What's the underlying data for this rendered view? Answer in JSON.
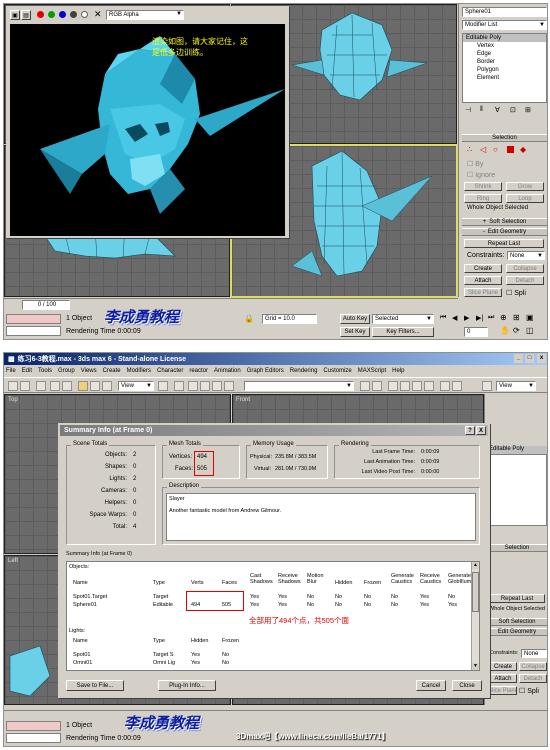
{
  "top": {
    "render_window": {
      "channel_select": "RGB Alpha",
      "caption_line1": "渲染如图，请大家记住，这",
      "caption_line2": "是低多边训练。"
    },
    "command_panel": {
      "object_name": "Sphere01",
      "modifier_list": "Modifier List",
      "stack": [
        "Editable Poly",
        "Vertex",
        "Edge",
        "Border",
        "Polygon",
        "Element"
      ],
      "selection_rollout": "Selection",
      "by_vertex": "By",
      "ignore_backfacing": "Ignore",
      "shrink": "Shrink",
      "grow": "Grow",
      "ring": "Ring",
      "loop": "Loop",
      "whole_object": "Whole Object Selected",
      "soft_selection": "Soft Selection",
      "edit_geometry": "Edit Geometry",
      "repeat_last": "Repeat Last",
      "constraints_label": "Constraints:",
      "constraints_value": "None",
      "create": "Create",
      "collapse": "Collapse",
      "attach": "Attach",
      "detach": "Detach",
      "slice_plane": "Slice Plane",
      "split": "Spli"
    },
    "status": {
      "frame_counter": "0 / 100",
      "object_count": "1 Object",
      "rendering_time": "Rendering Time  0:00:09",
      "grid": "Grid = 10.0",
      "auto_key": "Auto Key",
      "selected": "Selected",
      "set_key": "Set Key",
      "key_filters": "Key Filters...",
      "frame_value": "0",
      "watermark": "李成勇教程"
    }
  },
  "bottom": {
    "app_title": "练习6-3教程.max - 3ds max 6 - Stand-alone License",
    "menu": [
      "File",
      "Edit",
      "Tools",
      "Group",
      "Views",
      "Create",
      "Modifiers",
      "Character",
      "reactor",
      "Animation",
      "Graph Editors",
      "Rendering",
      "Customize",
      "MAXScript",
      "Help"
    ],
    "view_select": "View",
    "viewports": {
      "top": "Top",
      "front": "Front",
      "left": "Left"
    },
    "dialog": {
      "title": "Summary Info (at Frame 0)",
      "help_btn": "?",
      "close_btn": "X",
      "scene_totals": {
        "title": "Scene Totals",
        "rows": [
          {
            "label": "Objects:",
            "value": "2"
          },
          {
            "label": "Shapes:",
            "value": "0"
          },
          {
            "label": "Lights:",
            "value": "2"
          },
          {
            "label": "Cameras:",
            "value": "0"
          },
          {
            "label": "Helpers:",
            "value": "0"
          },
          {
            "label": "Space Warps:",
            "value": "0"
          },
          {
            "label": "Total:",
            "value": "4"
          }
        ]
      },
      "mesh_totals": {
        "title": "Mesh Totals",
        "vertices_label": "Vertices:",
        "vertices": "494",
        "faces_label": "Faces:",
        "faces": "505"
      },
      "memory": {
        "title": "Memory Usage",
        "physical_label": "Physical:",
        "physical": "235.8M / 383.5M",
        "virtual_label": "Virtual:",
        "virtual": "281.0M / 730.9M"
      },
      "rendering": {
        "title": "Rendering",
        "rows": [
          {
            "label": "Last Frame Time:",
            "value": "0:00:09"
          },
          {
            "label": "Last Animation Time:",
            "value": "0:00:09"
          },
          {
            "label": "Last Video Post Time:",
            "value": "0:00:00"
          }
        ]
      },
      "description": {
        "title": "Description",
        "line1": "Slayer",
        "line2": "Another fantastic model from Andrew Gilmour."
      },
      "summary_label": "Summary Info (at Frame 0)",
      "objects_label": "Objects:",
      "object_columns": [
        "Name",
        "Type",
        "Verts",
        "Faces",
        "Cast Shadows",
        "Receive Shadows",
        "Motion Blur",
        "Hidden",
        "Frozen",
        "Generate Caustics",
        "Receive Caustics",
        "Generate GlobIllum"
      ],
      "object_rows": [
        [
          "Spot01.Target",
          "Target",
          "",
          "",
          "Yes",
          "Yes",
          "No",
          "No",
          "No",
          "No",
          "Yes",
          "No"
        ],
        [
          "Sphere01",
          "Editable",
          "494",
          "505",
          "Yes",
          "Yes",
          "No",
          "No",
          "No",
          "No",
          "Yes",
          "Yes"
        ]
      ],
      "caption": "全部用了494个点，共505个面",
      "lights_label": "Lights:",
      "light_columns": [
        "Name",
        "Type",
        "Hidden",
        "Frozen"
      ],
      "light_rows": [
        [
          "Spot01",
          "Target S",
          "Yes",
          "No"
        ],
        [
          "Omni01",
          "Omni Lig",
          "Yes",
          "No"
        ]
      ],
      "save_btn": "Save to File...",
      "plugin_btn": "Plug-In Info...",
      "cancel_btn": "Cancel",
      "close_dialog_btn": "Close"
    },
    "command_panel": {
      "editable_poly": "Editable Poly",
      "selection": "Selection",
      "repeat_last": "Repeat Last",
      "whole_object": "Whole Object Selected",
      "soft_selection": "Soft Selection",
      "edit_geometry": "Edit Geometry",
      "constraints_label": "Constraints:",
      "constraints_value": "None",
      "create": "Create",
      "collapse": "Collapse",
      "attach": "Attach",
      "detach": "Detach",
      "slice_plane": "Slice Plane",
      "split": "Spli"
    },
    "status": {
      "object_count": "1 Object",
      "rendering_time": "Rendering Time  0:00:09",
      "watermark": "李成勇教程",
      "site": "3Dmax吧【www.lineca.com/lieBa/1771】"
    }
  }
}
